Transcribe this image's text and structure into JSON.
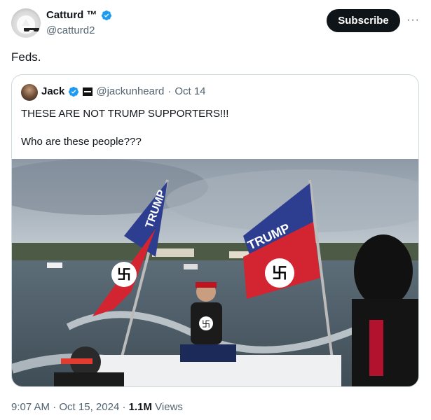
{
  "author": {
    "display_name": "Catturd ™",
    "handle": "@catturd2",
    "avatar_icon": "cat-avatar-icon",
    "verified_color": "#1d9bf0"
  },
  "actions": {
    "subscribe_label": "Subscribe",
    "more_label": "···"
  },
  "tweet": {
    "text": "Feds."
  },
  "quote": {
    "display_name": "Jack",
    "handle": "@jackunheard",
    "separator": "·",
    "date": "Oct 14",
    "line1": "THESE ARE NOT TRUMP SUPPORTERS!!!",
    "line2": "Who are these people???"
  },
  "photo": {
    "flag_text_left": "TRUMP",
    "flag_text_right": "TRUMP"
  },
  "footer": {
    "time": "9:07 AM",
    "separator1": "·",
    "date": "Oct 15, 2024",
    "separator2": "·",
    "views_count": "1.1M",
    "views_label": "Views"
  }
}
